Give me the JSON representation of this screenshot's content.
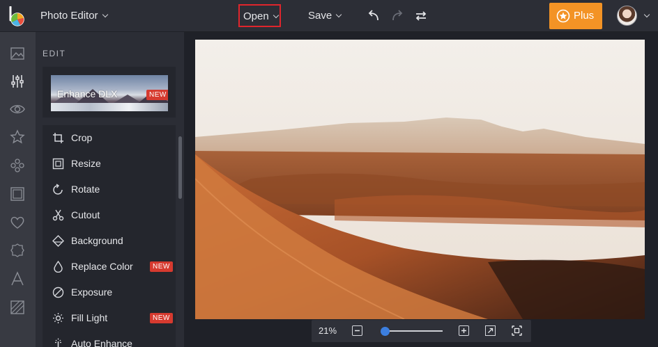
{
  "header": {
    "app_title": "Photo Editor",
    "open_label": "Open",
    "save_label": "Save",
    "plus_label": "Plus",
    "accent_color": "#f39325",
    "open_highlight_color": "#e0252c"
  },
  "leftnav": {
    "items": [
      "image-icon",
      "sliders-icon",
      "eye-icon",
      "star-icon",
      "flower-icon",
      "frame-icon",
      "heart-icon",
      "badge-icon",
      "text-icon",
      "texture-icon"
    ],
    "active": "sliders-icon"
  },
  "panel": {
    "heading": "EDIT",
    "feature": {
      "label": "Enhance DLX",
      "badge": "NEW"
    },
    "tools": [
      {
        "label": "Crop",
        "icon": "crop-icon",
        "badge": ""
      },
      {
        "label": "Resize",
        "icon": "resize-icon",
        "badge": ""
      },
      {
        "label": "Rotate",
        "icon": "rotate-icon",
        "badge": ""
      },
      {
        "label": "Cutout",
        "icon": "scissors-icon",
        "badge": ""
      },
      {
        "label": "Background",
        "icon": "background-icon",
        "badge": ""
      },
      {
        "label": "Replace Color",
        "icon": "drop-icon",
        "badge": "NEW"
      },
      {
        "label": "Exposure",
        "icon": "exposure-icon",
        "badge": ""
      },
      {
        "label": "Fill Light",
        "icon": "sun-icon",
        "badge": "NEW"
      },
      {
        "label": "Auto Enhance",
        "icon": "wand-icon",
        "badge": ""
      }
    ]
  },
  "zoom": {
    "level_label": "21%",
    "slider_value": 0.21
  }
}
